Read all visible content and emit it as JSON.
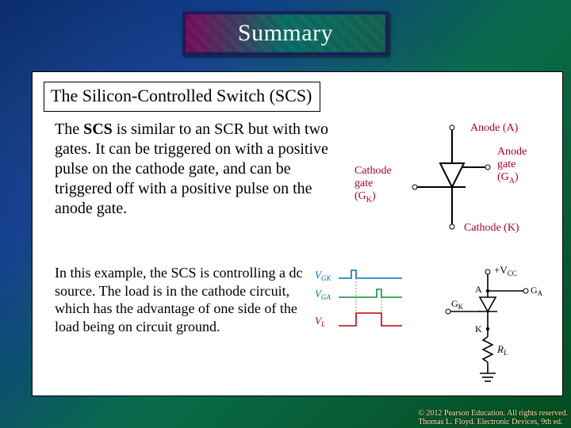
{
  "banner": {
    "title": "Summary"
  },
  "section": {
    "heading": "The Silicon-Controlled Switch (SCS)"
  },
  "body": {
    "para1_lead": "The ",
    "para1_bold": "SCS",
    "para1_rest": " is similar to an SCR but with two gates. It can be triggered on with a positive pulse on the cathode gate, and can be triggered off with a positive pulse on the anode gate.",
    "para2": "In this example, the SCS is controlling a dc source. The load is in the cathode circuit, which has the advantage of one side of the load being on circuit ground."
  },
  "symbol_diagram": {
    "anode_label": "Anode (A)",
    "anode_gate_label": "Anode",
    "anode_gate_label2": "gate",
    "anode_gate_sym": "(G",
    "anode_gate_sub": "A",
    "anode_gate_close": ")",
    "cathode_label": "Cathode (K)",
    "cathode_gate_label": "Cathode",
    "cathode_gate_label2": "gate",
    "cathode_gate_sym": "(G",
    "cathode_gate_sub": "K",
    "cathode_gate_close": ")"
  },
  "circuit_diagram": {
    "vcc": "+V",
    "vcc_sub": "CC",
    "A": "A",
    "GA": "G",
    "GA_sub": "A",
    "GK": "G",
    "GK_sub": "K",
    "K": "K",
    "RL": "R",
    "RL_sub": "L",
    "vgk": "V",
    "vgk_sub": "GK",
    "vga": "V",
    "vga_sub": "GA",
    "vl": "V",
    "vl_sub": "L"
  },
  "footer": {
    "copyright": "© 2012 Pearson Education. All rights reserved.\nThomas L. Floyd. Electronic Devices, 9th ed."
  }
}
